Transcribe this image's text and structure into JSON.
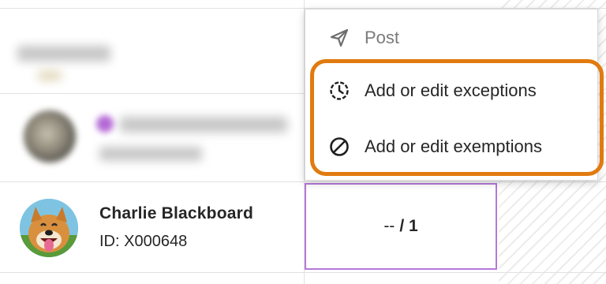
{
  "menu": {
    "items": [
      {
        "label": "Post",
        "icon": "paper-plane-icon",
        "disabled": true
      },
      {
        "label": "Add or edit exceptions",
        "icon": "clock-history-icon",
        "disabled": false
      },
      {
        "label": "Add or edit exemptions",
        "icon": "prohibited-icon",
        "disabled": false
      }
    ]
  },
  "student": {
    "name": "Charlie Blackboard",
    "id": "ID: X000648",
    "avatar": "dog-avatar"
  },
  "grade": {
    "value": "--",
    "possible": "/ 1"
  },
  "colors": {
    "highlight": "#e17a0f",
    "focus_border": "#b679d9",
    "text": "#262626"
  }
}
